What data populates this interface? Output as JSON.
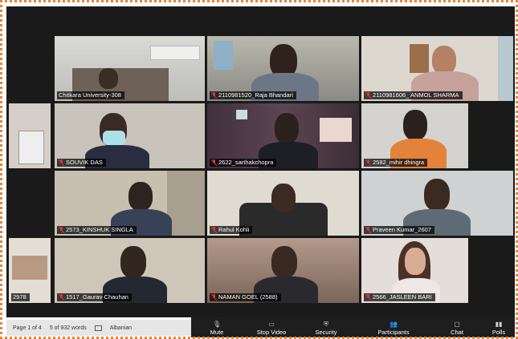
{
  "participants": [
    {
      "name": "Chitkara University-308",
      "muted": false
    },
    {
      "name": "2110981520_Raja Bhandari",
      "muted": true
    },
    {
      "name": "2110981606_ ANMOL SHARMA",
      "muted": true
    },
    {
      "name": "SOUVIK DAS",
      "muted": true
    },
    {
      "name": "2622_sarthakchopra",
      "muted": true
    },
    {
      "name": "2582_mihir dhingra",
      "muted": true
    },
    {
      "name": "2573_KINSHUK SINGLA",
      "muted": true
    },
    {
      "name": "Rahul Kohli",
      "muted": true
    },
    {
      "name": "Praveen Kumar_2607",
      "muted": true
    },
    {
      "name": "2978",
      "muted": false
    },
    {
      "name": "1517_Gaurav Chauhan",
      "muted": true
    },
    {
      "name": "NAMAN GOEL (2588)",
      "muted": true
    },
    {
      "name": "2566_JASLEEN BARI",
      "muted": true
    }
  ],
  "statusbar": {
    "page": "Page 1 of 4",
    "words": "5 of 932 words",
    "language": "Albanian"
  },
  "controls": {
    "mute": "Mute",
    "stop_video": "Stop Video",
    "security": "Security",
    "participants": "Participants",
    "chat": "Chat",
    "polls": "Polls"
  },
  "colors": {
    "active_speaker": "#9ccc3c",
    "border": "#e2843a",
    "muted_icon": "#e0342c"
  }
}
